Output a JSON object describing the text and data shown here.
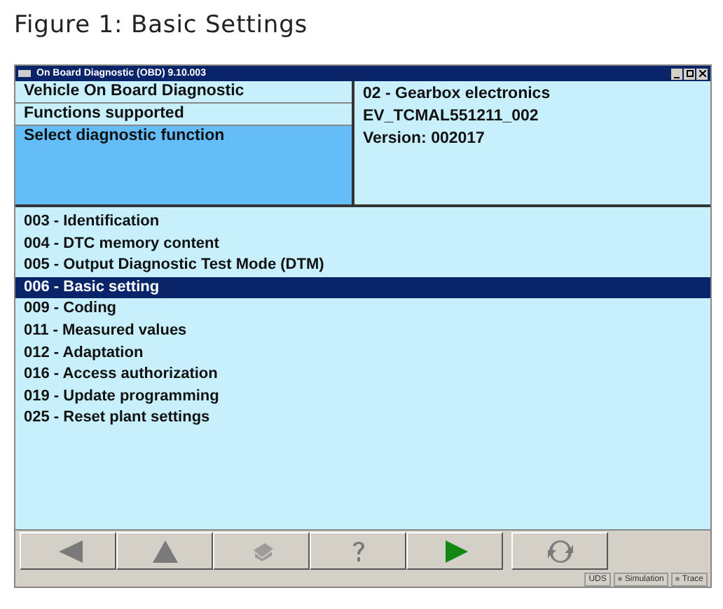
{
  "caption": "Figure 1: Basic Settings",
  "window": {
    "title": "On Board Diagnostic (OBD) 9.10.003"
  },
  "navigation": [
    {
      "label": "Vehicle On Board Diagnostic",
      "selected": false
    },
    {
      "label": "Functions supported",
      "selected": false
    },
    {
      "label": "Select diagnostic function",
      "selected": true
    }
  ],
  "control_unit": [
    "02 - Gearbox electronics",
    "EV_TCMAL551211_002",
    "Version: 002017"
  ],
  "functions": [
    {
      "label": "003 - Identification",
      "selected": false
    },
    {
      "label": "004 - DTC memory content",
      "selected": false
    },
    {
      "label": "005 - Output Diagnostic Test Mode (DTM)",
      "selected": false
    },
    {
      "label": "006 - Basic setting",
      "selected": true
    },
    {
      "label": "009 - Coding",
      "selected": false
    },
    {
      "label": "011 - Measured values",
      "selected": false
    },
    {
      "label": "012 - Adaptation",
      "selected": false
    },
    {
      "label": "016 - Access authorization",
      "selected": false
    },
    {
      "label": "019 - Update programming",
      "selected": false
    },
    {
      "label": "025 - Reset plant settings",
      "selected": false
    }
  ],
  "toolbar": [
    {
      "kind": "back",
      "disabled": true
    },
    {
      "kind": "up",
      "disabled": true
    },
    {
      "kind": "print",
      "disabled": true
    },
    {
      "kind": "help",
      "disabled": true
    },
    {
      "kind": "next",
      "disabled": false
    },
    {
      "kind": "refresh",
      "disabled": true
    }
  ],
  "status_bar": {
    "protocol": "UDS",
    "indicators": [
      "Simulation",
      "Trace"
    ]
  }
}
